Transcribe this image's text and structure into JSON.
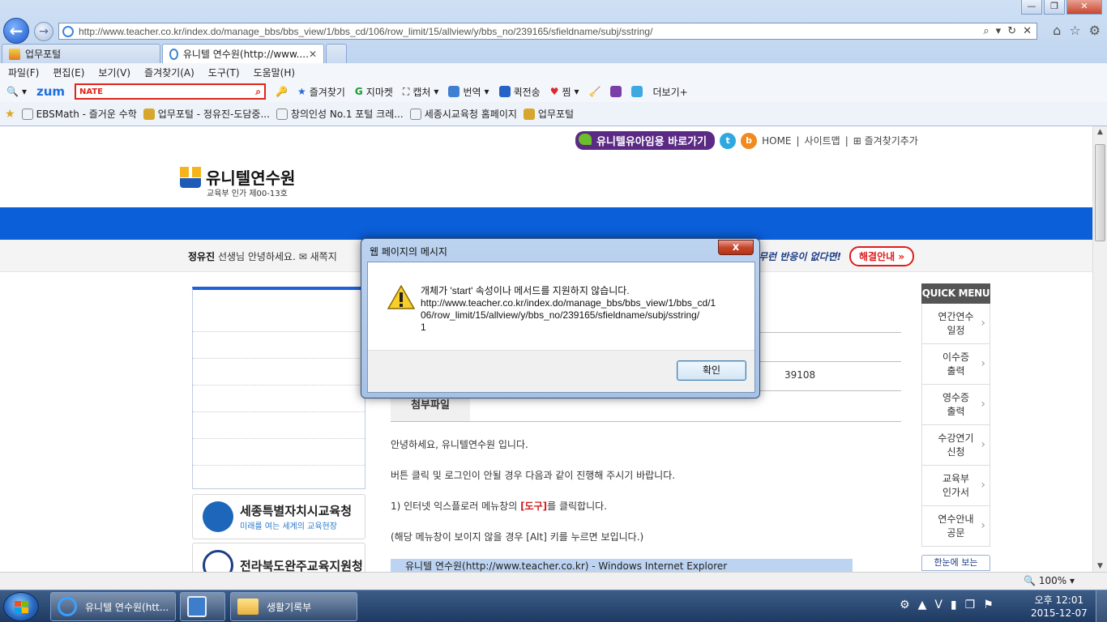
{
  "browser": {
    "address_url": "http://www.teacher.co.kr/index.do/manage_bbs/bbs_view/1/bbs_cd/106/row_limit/15/allview/y/bbs_no/239165/sfieldname/subj/sstring/",
    "tabs": [
      {
        "label": "업무포털"
      },
      {
        "label": "유니텔 연수원(http://www...."
      }
    ],
    "menu": [
      "파일(F)",
      "편집(E)",
      "보기(V)",
      "즐겨찾기(A)",
      "도구(T)",
      "도움말(H)"
    ],
    "command_bar": {
      "zum": "zum",
      "nate": "NATE",
      "items": [
        "즐겨찾기",
        "지마켓",
        "캡처",
        "번역",
        "퀵전송",
        "찜",
        "더보기+"
      ]
    },
    "favorites": [
      "EBSMath - 즐거운 수학",
      "업무포털 - 정유진-도담중...",
      "창의인성 No.1 포털 크레...",
      "세종시교육청 홈페이지",
      "업무포털"
    ],
    "zoom": "100%"
  },
  "site": {
    "top_links": {
      "kinder_button": "유니텔유아임용 바로가기",
      "home": "HOME",
      "sitemap": "사이트맵",
      "add_favorite": "즐겨찾기추가"
    },
    "logo_title": "유니텔연수원",
    "logo_sub": "교육부 인가 제00-13호",
    "greeting_name": "정유진",
    "greeting_text": "선생님 안녕하세요.",
    "greeting_mail": "새쪽지",
    "notice_text": "무런 반응이 없다면!",
    "solve_button": "해결안내",
    "banners": [
      {
        "title": "세종특별자치시교육청",
        "sub": "미래를 여는 세계의 교육현장"
      },
      {
        "title": "전라북도완주교육지원청",
        "sub": ""
      }
    ],
    "content": {
      "number": "39108",
      "attach_label": "첨부파일",
      "para1": "안녕하세요, 유니텔연수원 입니다.",
      "para2": "버튼 클릭 및 로그인이 안될 경우 다음과 같이 진행해 주시기 바랍니다.",
      "para3_pre": "1) 인터넷 익스플로러 메뉴창의 ",
      "para3_red": "[도구]",
      "para3_post": "를 클릭합니다.",
      "para4": "(해당 메뉴창이 보이지 않을 경우 [Alt] 키를 누르면 보입니다.)",
      "ie_strip": "유니텔 연수원(http://www.teacher.co.kr) - Windows Internet Explorer"
    },
    "quick_menu": {
      "title": "QUICK MENU",
      "items": [
        "연간연수\n일정",
        "이수증\n출력",
        "영수증\n출력",
        "수강연기\n신청",
        "교육부\n인가서",
        "연수안내\n공문"
      ],
      "more": "한눈에 보는"
    }
  },
  "dialog": {
    "title": "웹 페이지의 메시지",
    "close": "x",
    "lines": [
      "개체가 'start' 속성이나 메서드를 지원하지 않습니다.",
      "http://www.teacher.co.kr/index.do/manage_bbs/bbs_view/1/bbs_cd/1",
      "06/row_limit/15/allview/y/bbs_no/239165/sfieldname/subj/sstring/",
      "1"
    ],
    "ok_label": "확인"
  },
  "taskbar": {
    "items": [
      {
        "label": "유니텔 연수원(htt..."
      },
      {
        "label": ""
      },
      {
        "label": "생활기록부"
      }
    ],
    "clock_time": "오후 12:01",
    "clock_date": "2015-12-07"
  },
  "colors": {
    "site_blue": "#0b5fd9",
    "alert_red": "#e01b1b",
    "kinder_purple": "#5b2a85"
  }
}
